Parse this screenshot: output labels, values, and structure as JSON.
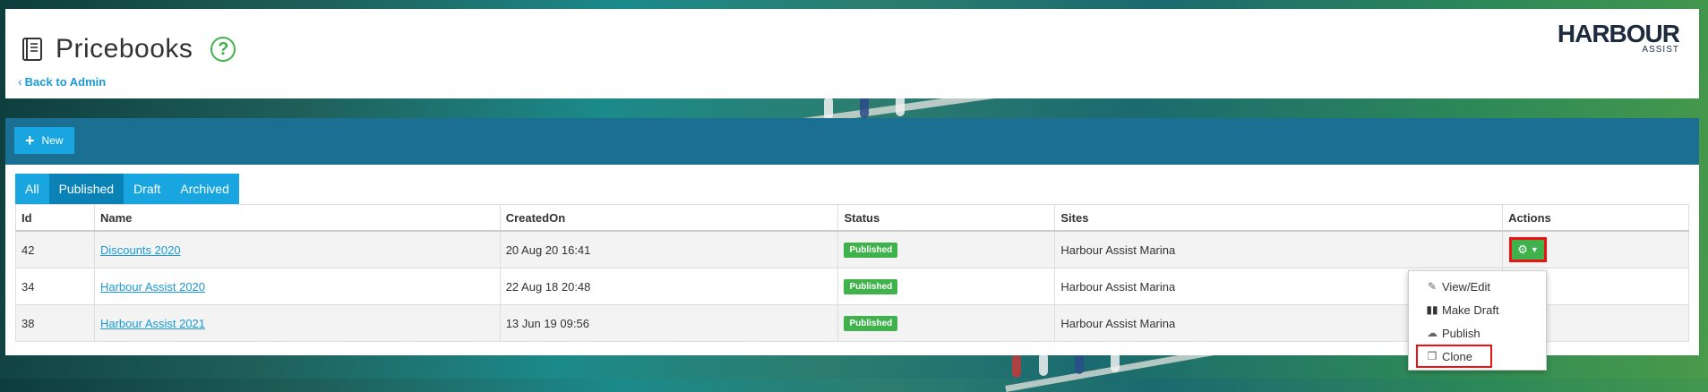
{
  "header": {
    "title": "Pricebooks",
    "help_symbol": "?",
    "back_link": "Back to Admin",
    "logo_main": "HARBOUR",
    "logo_sub": "ASSIST"
  },
  "toolbar": {
    "new_label": "New"
  },
  "tabs": [
    {
      "label": "All",
      "active": false
    },
    {
      "label": "Published",
      "active": true
    },
    {
      "label": "Draft",
      "active": false
    },
    {
      "label": "Archived",
      "active": false
    }
  ],
  "table": {
    "columns": [
      "Id",
      "Name",
      "CreatedOn",
      "Status",
      "Sites",
      "Actions"
    ],
    "rows": [
      {
        "id": "42",
        "name": "Discounts 2020",
        "created": "20 Aug 20 16:41",
        "status": "Published",
        "site": "Harbour Assist Marina"
      },
      {
        "id": "34",
        "name": "Harbour Assist 2020",
        "created": "22 Aug 18 20:48",
        "status": "Published",
        "site": "Harbour Assist Marina"
      },
      {
        "id": "38",
        "name": "Harbour Assist 2021",
        "created": "13 Jun 19 09:56",
        "status": "Published",
        "site": "Harbour Assist Marina"
      }
    ]
  },
  "actions_menu": {
    "items": [
      "View/Edit",
      "Make Draft",
      "Publish",
      "Clone"
    ],
    "highlighted": "Clone"
  },
  "colors": {
    "accent_blue": "#19a6e0",
    "bar_teal": "#1b6f92",
    "status_green": "#3fb24c",
    "link_blue": "#1a9ad6",
    "highlight_red": "#ee1111"
  }
}
